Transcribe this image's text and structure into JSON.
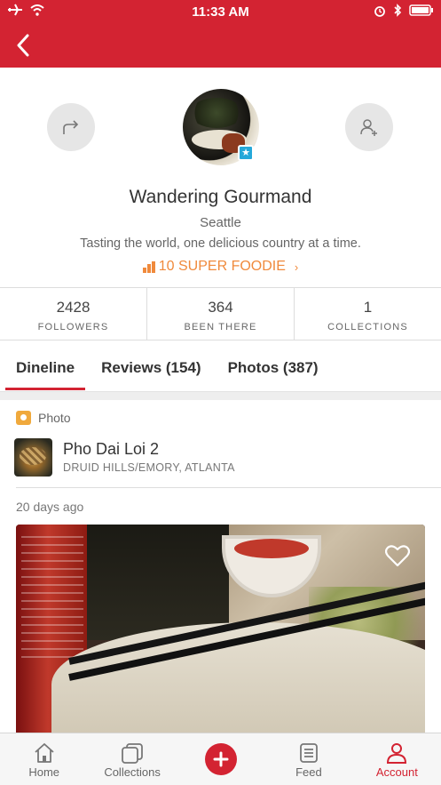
{
  "status_bar": {
    "time": "11:33 AM"
  },
  "header": {
    "back_icon": "chevron-left-icon"
  },
  "profile": {
    "name": "Wandering Gourmand",
    "city": "Seattle",
    "tagline": "Tasting the world, one delicious country at a time.",
    "foodie_badge": "10 SUPER FOODIE",
    "share_icon": "share-arrow-icon",
    "follow_icon": "add-user-icon"
  },
  "stats": [
    {
      "value": "2428",
      "label": "FOLLOWERS"
    },
    {
      "value": "364",
      "label": "BEEN THERE"
    },
    {
      "value": "1",
      "label": "COLLECTIONS"
    }
  ],
  "tabs": [
    {
      "label": "Dineline",
      "active": true
    },
    {
      "label": "Reviews (154)",
      "active": false
    },
    {
      "label": "Photos (387)",
      "active": false
    }
  ],
  "feed_item": {
    "type_label": "Photo",
    "restaurant_name": "Pho Dai Loi 2",
    "location": "DRUID HILLS/EMORY, ATLANTA",
    "time_ago": "20 days ago"
  },
  "tab_bar": [
    {
      "label": "Home",
      "icon": "home-icon"
    },
    {
      "label": "Collections",
      "icon": "collections-icon"
    },
    {
      "label": "",
      "icon": "add-icon"
    },
    {
      "label": "Feed",
      "icon": "feed-icon"
    },
    {
      "label": "Account",
      "icon": "account-icon",
      "active": true
    }
  ],
  "colors": {
    "brand_red": "#d32332",
    "foodie_orange": "#f08a3c",
    "badge_blue": "#25a8d9"
  }
}
